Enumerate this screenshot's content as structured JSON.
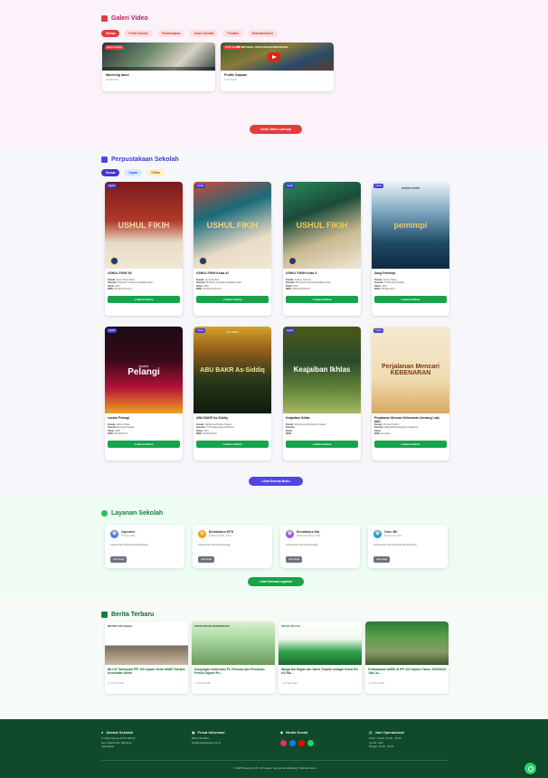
{
  "gallery": {
    "title": "Galeri Video",
    "filters": [
      "Semua",
      "Profil Sekolah",
      "Pembelajaran",
      "Acara Sekolah",
      "Prestasi",
      "Ekstrakurikuler"
    ],
    "videos": [
      {
        "badge": "Acara Sekolah",
        "title": "Marching band",
        "date": "18/06/2025"
      },
      {
        "badge": "Profil Sekolah",
        "title": "Profile Sapuan",
        "date": "11/07/2025",
        "thumb_text": "PP. MIFTAHUL HUDA PESANTREN PROFIL"
      }
    ],
    "more_button": "Lihat Video Lainnya"
  },
  "library": {
    "title": "Perpustakaan Sekolah",
    "filters": [
      "Semua",
      "Digital",
      "Offline"
    ],
    "books": [
      {
        "tag": "Digital",
        "cover": "USHUL FIKIH",
        "title": "USHUL FIKIH XII",
        "penulis": "Asmul Hanaf Hariri",
        "penerbit": "Direktorat Jenderal Pendidikan Islam",
        "tahun": "2020",
        "isbn": "978-623-6729-34-1"
      },
      {
        "tag": "Digital",
        "cover": "USHUL FIKIH",
        "title": "USHUL FIKIH Kelas XI",
        "penulis": "Jamrosid Zaini",
        "penerbit": "Direktorat Jenderal Pendidikan Islam",
        "tahun": "2020",
        "isbn": "978-623-6729-30-3"
      },
      {
        "tag": "Digital",
        "cover": "USHUL FIKIH",
        "title": "USHUL FIKIH Kelas X",
        "penulis": "Sutikno, Rohman",
        "penerbit": "Direktorat Jenderal Pendidikan Islam",
        "tahun": "2020",
        "isbn": "978-623-6729-29-7"
      },
      {
        "tag": "Digital",
        "cover": "pemimpi",
        "cover_author": "andrea hirata",
        "title": "Sang Pemimpi",
        "penulis": "Andrea Hirata",
        "penerbit": "PT Bentang Pustaka",
        "tahun": "2006",
        "isbn": "979-3062-92-4"
      },
      {
        "tag": "Digital",
        "cover": "Pelangi",
        "cover_pre": "laskar",
        "title": "Laskar Pelangi",
        "penulis": "Andrea Hirata",
        "penerbit": "Bentang Pustaka",
        "tahun": "2005",
        "isbn": "979-3062-79-7"
      },
      {
        "tag": "Digital",
        "cover": "ABU BAKR As-Siddiq",
        "cover_sub": "Seri Rasul",
        "title": "ABU BAKR As-Siddiq",
        "penulis": "Muhammad Husain Haekal",
        "penerbit": "PT Pustaka Litera AntarNusa",
        "tahun": "2001",
        "isbn": "979-8100-56-6"
      },
      {
        "tag": "Digital",
        "cover": "Keajaiban Ikhlas",
        "title": "Keajaiban Ikhlas",
        "penulis": "Muhammad Khoirudin Al Husaini",
        "penerbit": "",
        "tahun": "",
        "isbn": ""
      },
      {
        "tag": "Digital",
        "cover": "Perjalanan Mencari KEBENARAN",
        "title": "Perjalanan Mencari Kebenaran (tentang Laki-laki...",
        "penulis": "M. Arief Al Jahro",
        "penerbit": "salafi-albahra.blogspot.com/jilid.org",
        "tahun": "",
        "isbn": "Kumpulan"
      }
    ],
    "labels": {
      "penulis": "Penulis",
      "penerbit": "Penerbit",
      "tahun": "Tahun",
      "isbn": "ISBN"
    },
    "read_button": "Baca Online",
    "more_button": "Lihat Semua Buku"
  },
  "services": {
    "title": "Layanan Sekolah",
    "items": [
      {
        "name": "Operator",
        "role": "H. Abdul Malik",
        "desc": "Layanan dan Informasi Data Madrasah",
        "button": "Lihat Detail"
      },
      {
        "name": "Bendahara MTS",
        "role": "Fadilah Mustafa, S.Pd.I",
        "desc": "Layanan dan Informasi Keuangan",
        "button": "Lihat Detail"
      },
      {
        "name": "Bendahara MA",
        "role": "Nabila Ramadhani, S.Pd",
        "desc": "Layanan dan Informasi Keuangan",
        "button": "Lihat Detail"
      },
      {
        "name": "Guru BK",
        "role": "Siti Nur Aini, S.Pd",
        "desc": "Layanan dan Informasi Bimbingan Konseling",
        "button": "Lihat Detail"
      }
    ],
    "more_button": "Lihat Semua Layanan"
  },
  "news": {
    "title": "Berita Terbaru",
    "items": [
      {
        "title": "Bb UG Tasmiyyah PPI 103 Arjawri Gelar MABIT Bertani Kesehatan Santri",
        "date": "17 Nov 2025",
        "img_text": "MA PPI 103 Arjawri"
      },
      {
        "title": "Kunjungan Kaderisasi PC Pemuda dan Persatuan Pemilu Arjawri Pe...",
        "date": "10 Nov 2025",
        "img_text": "KUNJUNGAN KADERISASI"
      },
      {
        "title": "Warga MA Hajjah dan Zahra Terpilih sebagai Ketua RU UG Ma...",
        "date": "10 Nov 2025",
        "img_text": "KETUA RU-UG"
      },
      {
        "title": "Pelaksanaan ANBK di PPI 103 Arjawri Tahun 2025/2026 Jibu Ju...",
        "date": "04 Nov 2025",
        "img_text": ""
      }
    ]
  },
  "footer": {
    "cols": [
      {
        "title": "Alamat Sekolah",
        "lines": [
          "Jl. Raya Sapuan RT.01 RW.07",
          "Kec. Arjawri Kab. Bandung",
          "Jawa Barat"
        ]
      },
      {
        "title": "Pusat Informasi",
        "lines": [
          "0822-720-4847",
          "info@ppi103arjawri.sch.id"
        ]
      },
      {
        "title": "Media Sosial",
        "lines": []
      },
      {
        "title": "Jam Operasional",
        "lines": [
          "Senin - Kamis: 07.00 - 15.00",
          "Jum'at: Libur",
          "Minggu: 07.00 - 14.00"
        ]
      }
    ],
    "copyright": "© 2025 Pesantren PPI 103 Arjawri. Semua hak dilindungi | Website Resmi"
  },
  "colors": {
    "accent_red": "#e23d3d",
    "accent_purple": "#4f46e5",
    "accent_green": "#16a34a",
    "footer_bg": "#0f4a2a"
  }
}
